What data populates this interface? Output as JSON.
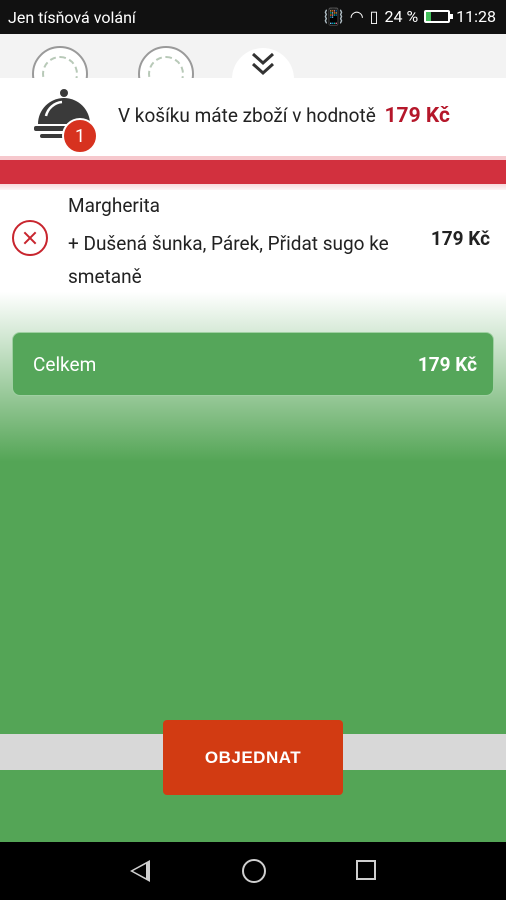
{
  "status_bar": {
    "carrier": "Jen tísňová volání",
    "battery": "24 %",
    "time": "11:28"
  },
  "cart": {
    "message": "V košíku máte zboží v hodnotě",
    "total_price": "179 Kč",
    "item_count": "1"
  },
  "items": [
    {
      "name": "Margherita",
      "extras": "+ Dušená šunka, Párek, Přidat sugo ke smetaně",
      "price": "179 Kč"
    }
  ],
  "summary": {
    "label": "Celkem",
    "value": "179 Kč"
  },
  "actions": {
    "order": "OBJEDNAT"
  },
  "colors": {
    "accent_red": "#d2303e",
    "price_red": "#b5172a",
    "order_button": "#d23b12",
    "background_green": "#54a556"
  }
}
